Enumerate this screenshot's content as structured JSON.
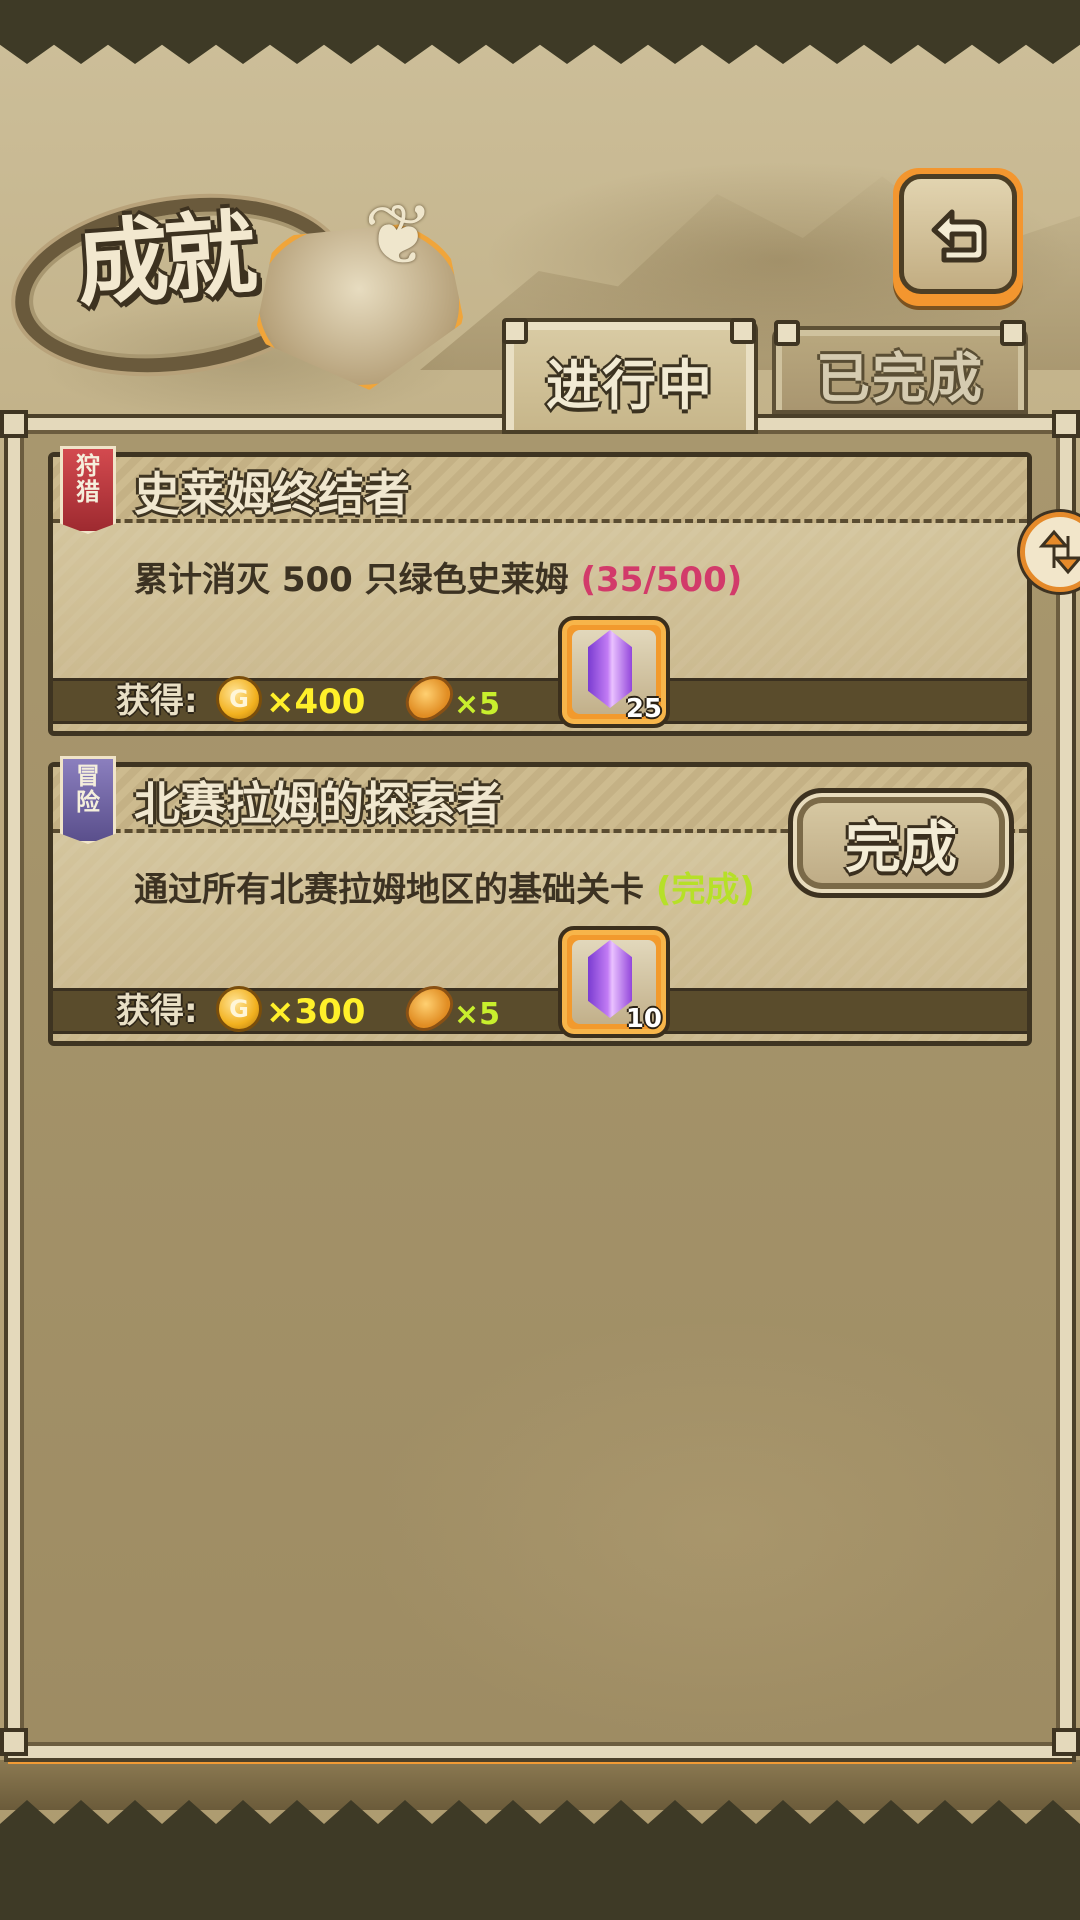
{
  "header": {
    "title": "成就",
    "back_icon": "back-arrow-icon"
  },
  "tabs": [
    {
      "label": "进行中",
      "active": true
    },
    {
      "label": "已完成",
      "active": false
    }
  ],
  "achievements": [
    {
      "category": "狩猎",
      "category_color": "#b8323a",
      "title": "史莱姆终结者",
      "description": "累计消灭 500 只绿色史莱姆",
      "progress": "(35/500)",
      "reward_label": "获得:",
      "coin_symbol": "G",
      "coins": "×400",
      "bread": "×5",
      "gems": "25"
    },
    {
      "category": "冒险",
      "category_color": "#6a5fa0",
      "title": "北赛拉姆的探索者",
      "description": "通过所有北赛拉姆地区的基础关卡",
      "progress": "(完成)",
      "reward_label": "获得:",
      "coin_symbol": "G",
      "coins": "×300",
      "bread": "×5",
      "gems": "10",
      "button": "完成"
    }
  ],
  "colors": {
    "accent_orange": "#f29a2d",
    "progress_pink": "#d23a6a",
    "progress_green": "#b6e028",
    "coin_yellow": "#fff02a"
  }
}
